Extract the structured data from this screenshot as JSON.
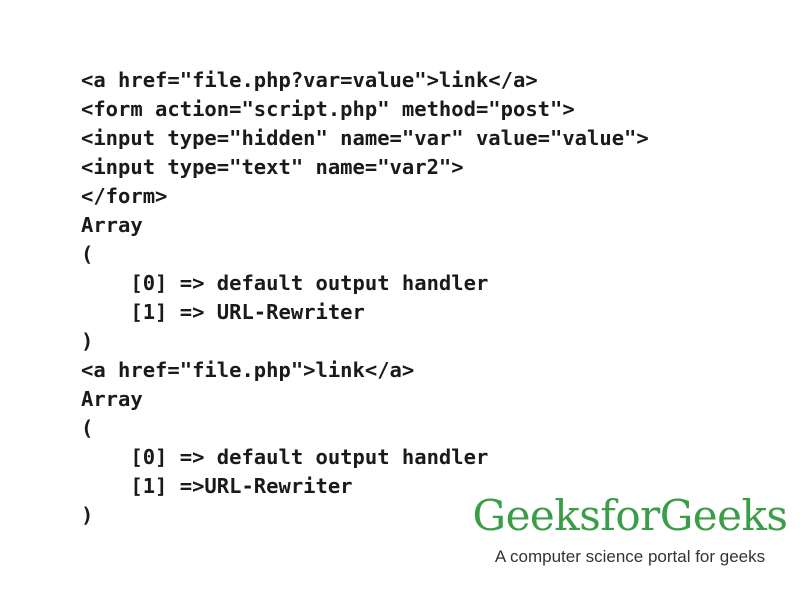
{
  "code_output": {
    "lines": [
      "<a href=\"file.php?var=value\">link</a>",
      "<form action=\"script.php\" method=\"post\">",
      "<input type=\"hidden\" name=\"var\" value=\"value\">",
      "<input type=\"text\" name=\"var2\">",
      "</form>",
      "Array",
      "(",
      "    [0] => default output handler",
      "    [1] => URL-Rewriter",
      ")",
      "<a href=\"file.php\">link</a>",
      "Array",
      "(",
      "    [0] => default output handler",
      "    [1] =>URL-Rewriter",
      ")"
    ]
  },
  "logo": {
    "name": "GeeksforGeeks",
    "tagline": "A computer science portal for geeks",
    "color": "#3a9d47"
  }
}
